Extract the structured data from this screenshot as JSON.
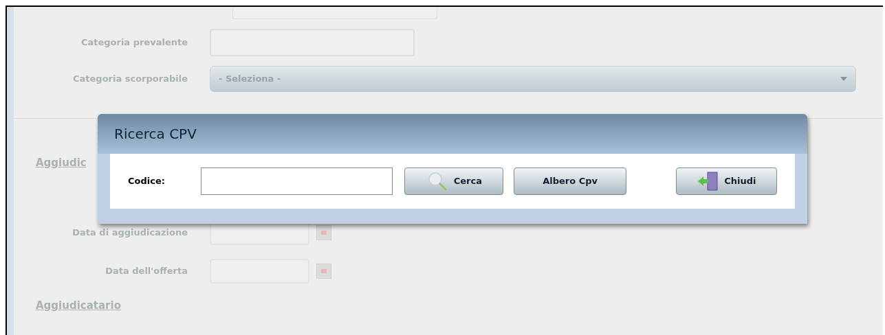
{
  "form": {
    "fields": [
      {
        "kind": "text",
        "label": "Categoria prevalente"
      },
      {
        "kind": "select",
        "label": "Categoria scorporabile",
        "value": "- Seleziona -"
      }
    ],
    "section_heading": "Aggiudic",
    "date_fields": [
      {
        "label": "Data di aggiudicazione"
      },
      {
        "label": "Data dell'offerta"
      }
    ],
    "second_heading": "Aggiudicatario"
  },
  "dialog": {
    "title": "Ricerca CPV",
    "field_label": "Codice:",
    "buttons": [
      {
        "kind": "search",
        "label": "Cerca"
      },
      {
        "kind": "plain",
        "label": "Albero Cpv"
      },
      {
        "kind": "close",
        "label": "Chiudi"
      }
    ]
  }
}
